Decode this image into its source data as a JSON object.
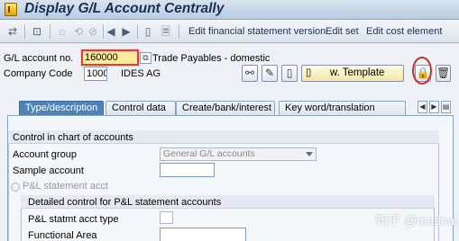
{
  "window": {
    "title": "Display G/L Account Centrally"
  },
  "toolbar": {
    "edit_fin_stmt_version": "Edit financial statement version",
    "edit_set": "Edit set",
    "edit_cost_element": "Edit cost element"
  },
  "header": {
    "gl_account_label": "G/L account no.",
    "gl_account_value": "160000",
    "gl_account_desc": "Trade Payables - domestic",
    "company_code_label": "Company Code",
    "company_code_value": "1000",
    "company_name": "IDES AG",
    "template_button": "w. Template"
  },
  "tabs": [
    {
      "label": "Type/description",
      "active": true
    },
    {
      "label": "Control data",
      "active": false
    },
    {
      "label": "Create/bank/interest",
      "active": false
    },
    {
      "label": "Key word/translation",
      "active": false
    }
  ],
  "coa_control": {
    "group_title": "Control in chart of accounts",
    "account_group_label": "Account group",
    "account_group_value": "General G/L accounts",
    "sample_account_label": "Sample account",
    "sample_account_value": "",
    "pl_statement_acct_label": "P&L statement acct"
  },
  "pl_control": {
    "group_title": "Detailed control for P&L statement accounts",
    "pl_statmt_acct_type_label": "P&L statmt acct type",
    "functional_area_label": "Functional Area",
    "functional_area_value": ""
  },
  "watermark": "知乎 @matinal",
  "colors": {
    "active_tab": "#4f82b6",
    "focus_field_bg": "#ffea9a",
    "highlight_circle": "#c8302a",
    "title_text": "#1b2f52"
  }
}
